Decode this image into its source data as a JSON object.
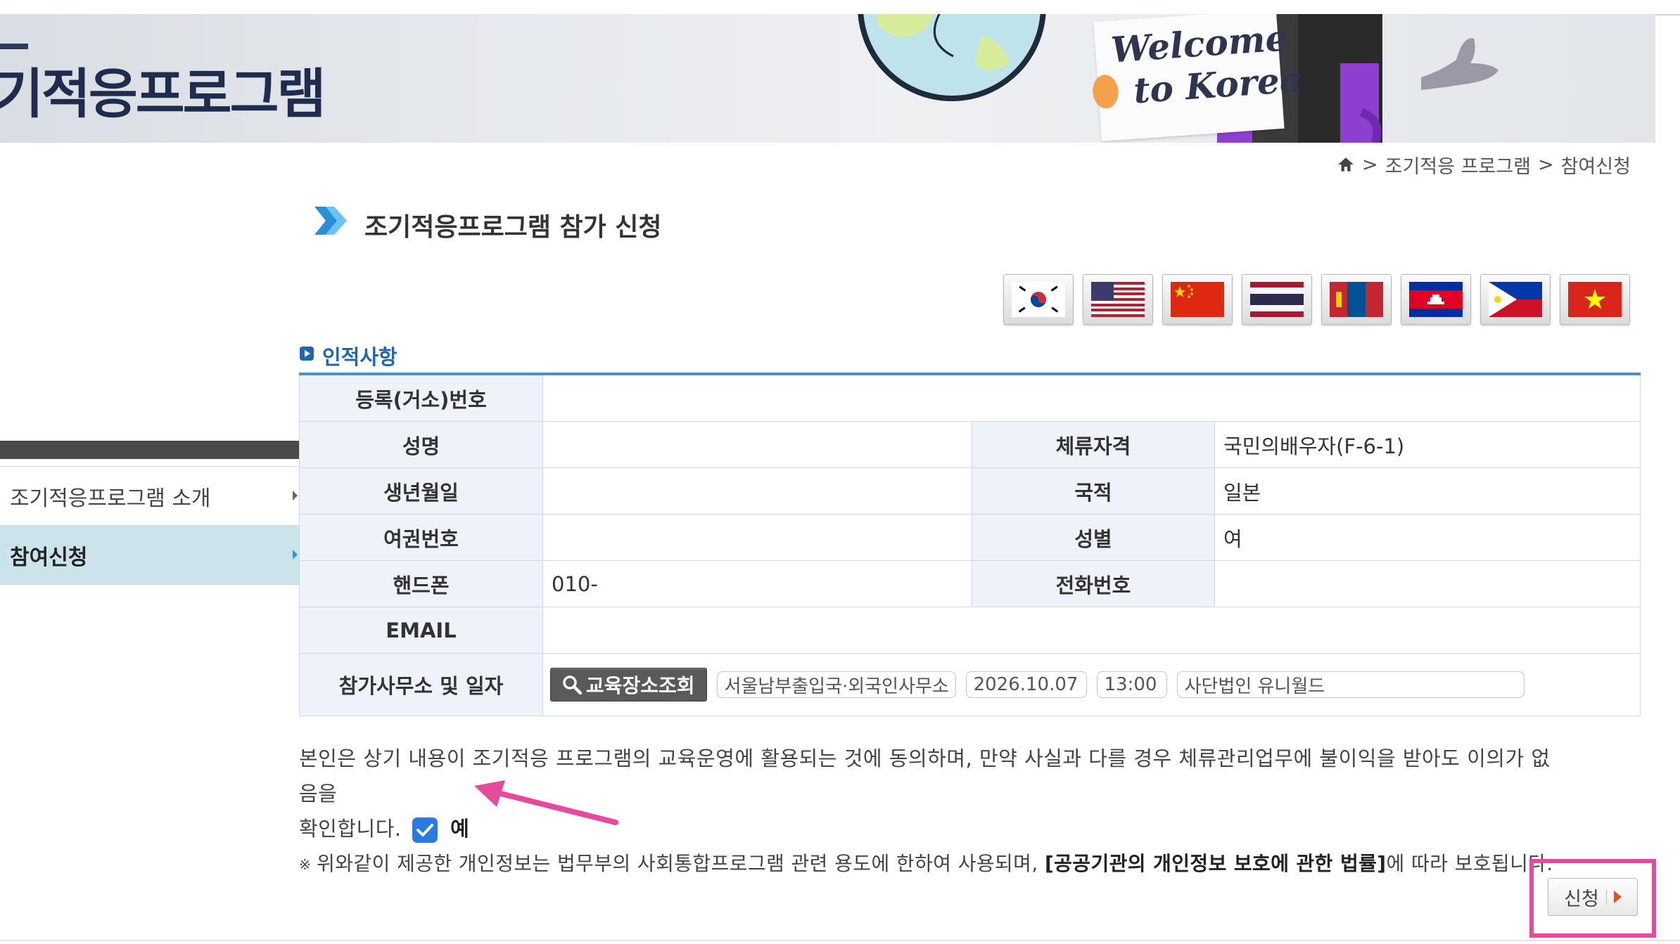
{
  "banner": {
    "title": "기적응프로그램",
    "welcome_line1": "Welcome",
    "welcome_line2": "to Korea"
  },
  "breadcrumb": {
    "items": [
      ">",
      "조기적응 프로그램",
      ">",
      "참여신청"
    ]
  },
  "page_title": "조기적응프로그램 참가 신청",
  "languages": [
    {
      "name": "korea-flag"
    },
    {
      "name": "usa-flag"
    },
    {
      "name": "china-flag"
    },
    {
      "name": "thailand-flag"
    },
    {
      "name": "mongolia-flag"
    },
    {
      "name": "cambodia-flag"
    },
    {
      "name": "philippines-flag"
    },
    {
      "name": "vietnam-flag"
    }
  ],
  "sidebar": {
    "items": [
      {
        "label": "조기적응프로그램 소개",
        "active": false
      },
      {
        "label": "참여신청",
        "active": true
      }
    ]
  },
  "section": {
    "label": "인적사항"
  },
  "form": {
    "registration_label": "등록(거소)번호",
    "registration_value": "",
    "name_label": "성명",
    "name_value": "",
    "visa_label": "체류자격",
    "visa_value": "국민의배우자(F-6-1)",
    "birth_label": "생년월일",
    "birth_value": "",
    "nationality_label": "국적",
    "nationality_value": "일본",
    "passport_label": "여권번호",
    "passport_value": "",
    "gender_label": "성별",
    "gender_value": "여",
    "mobile_label": "핸드폰",
    "mobile_value": "010-",
    "phone_label": "전화번호",
    "phone_value": "",
    "email_label": "EMAIL",
    "email_value": "",
    "office_label": "참가사무소 및 일자",
    "search_button": "교육장소조회",
    "office_value": "서울남부출입국·외국인사무소",
    "date_value": "2026.10.07",
    "time_value": "13:00",
    "org_value": "사단법인 유니월드"
  },
  "consent": {
    "text_line1": "본인은 상기 내용이 조기적응 프로그램의 교육운영에 활용되는 것에 동의하며, 만약 사실과 다를 경우 체류관리업무에 불이익을 받아도 이의가 없음을",
    "text_line2": "확인합니다.",
    "checked": true,
    "yes_label": "예"
  },
  "notice": {
    "mark": "※",
    "text_before": "위와같이 제공한 개인정보는 법무부의 사회통합프로그램 관련 용도에 한하여 사용되며, ",
    "text_bold": "[공공기관의 개인정보 보호에 관한 법률]",
    "text_after": "에 따라 보호됩니다."
  },
  "submit": {
    "label": "신청"
  },
  "colors": {
    "accent_blue": "#2366b0",
    "table_top_border": "#4a90c8",
    "label_bg": "#edf3f8",
    "sidebar_active": "#cde3ec",
    "highlight_pink": "#e54a9e",
    "checkbox_blue": "#2a7ae2"
  }
}
